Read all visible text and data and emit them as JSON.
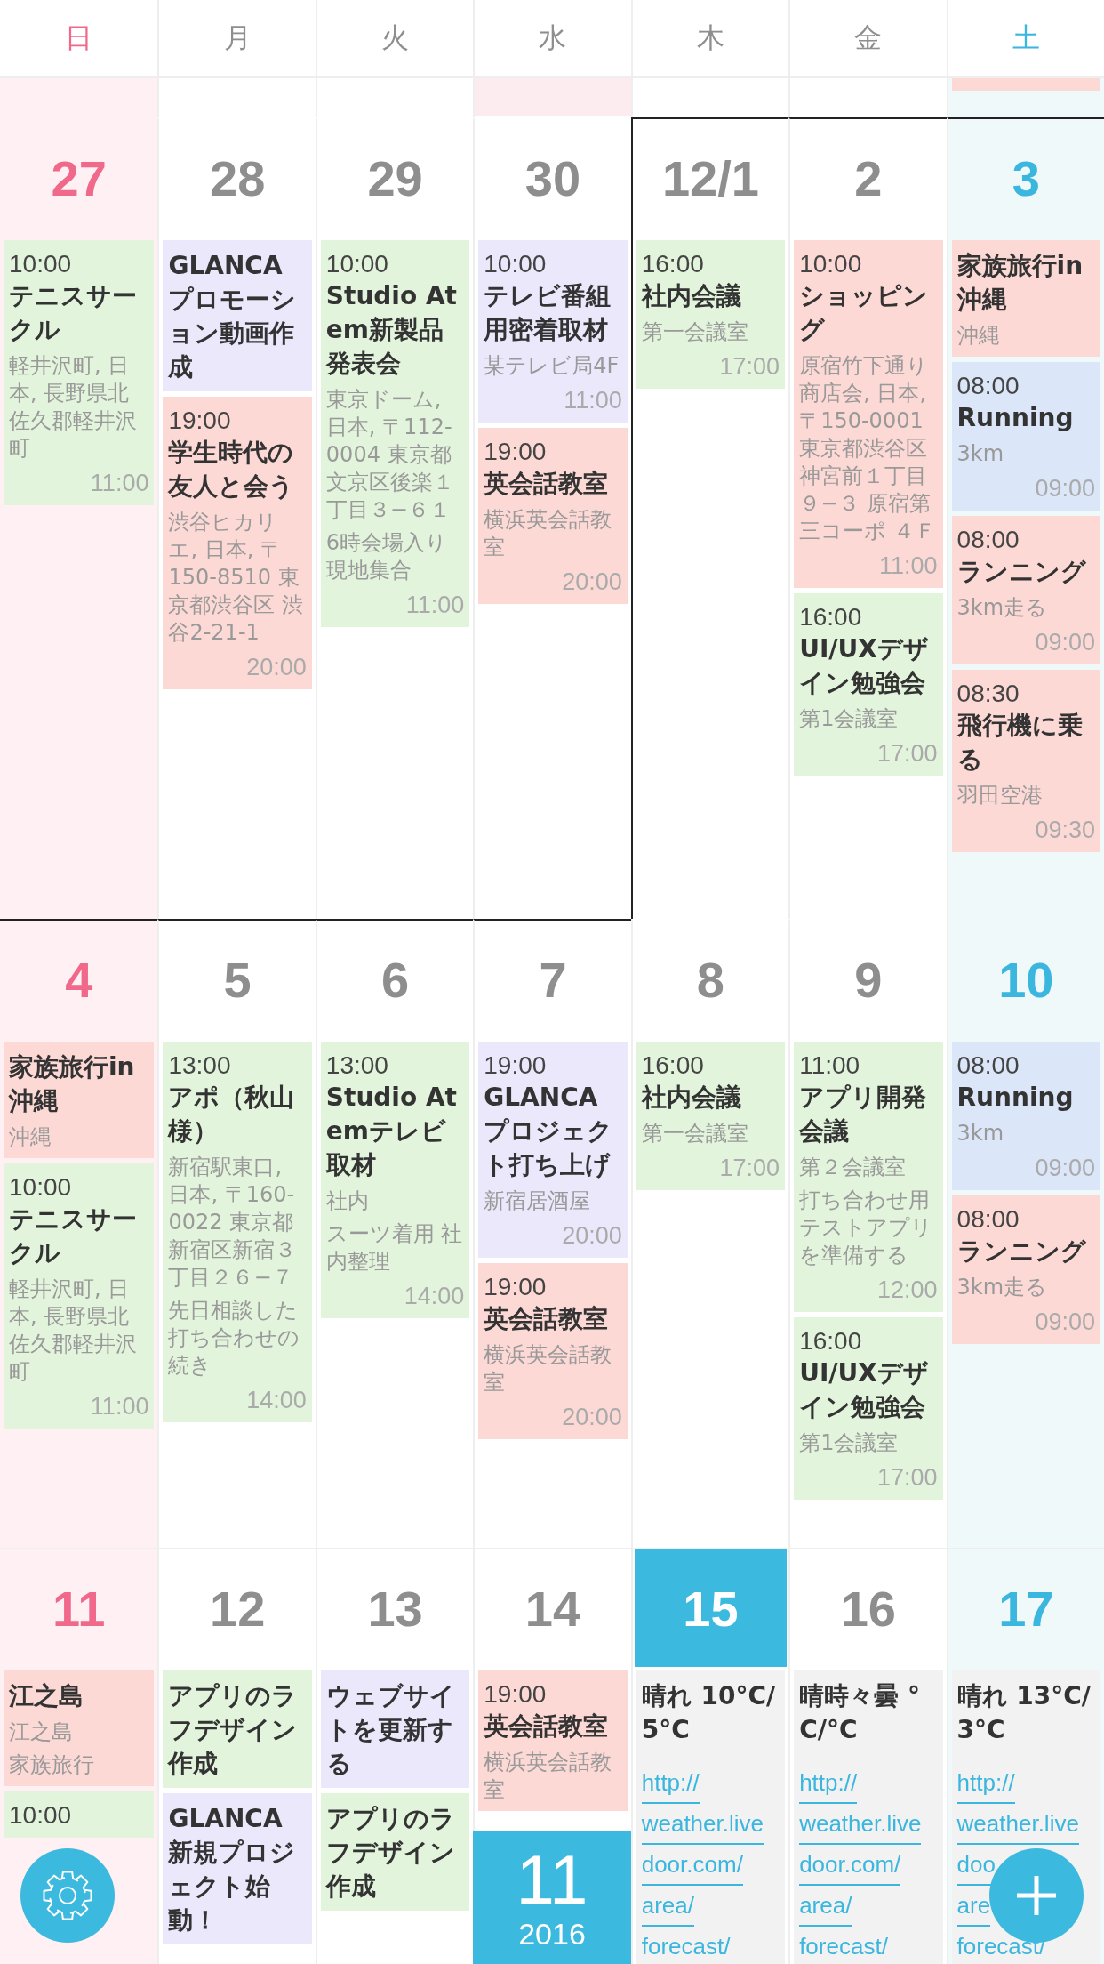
{
  "weekdays": [
    "日",
    "月",
    "火",
    "水",
    "木",
    "金",
    "土"
  ],
  "previous_week_edge": [
    {
      "kind": "none"
    },
    {
      "kind": "none"
    },
    {
      "kind": "none"
    },
    {
      "kind": "full",
      "color": "#fdecef"
    },
    {
      "kind": "none"
    },
    {
      "kind": "none"
    },
    {
      "kind": "edge",
      "color": "#fdd9d6"
    }
  ],
  "weeks": [
    {
      "days": [
        {
          "number": "27",
          "other_month": true,
          "today": false,
          "events": [
            {
              "kind": "event",
              "color": "#e3f4dc",
              "time": "10:00",
              "title": "テニスサークル",
              "details": [
                "軽井沢町, 日本, 長野県北佐久郡軽井沢町"
              ],
              "end": "11:00"
            }
          ]
        },
        {
          "number": "28",
          "other_month": true,
          "today": false,
          "events": [
            {
              "kind": "event",
              "color": "#ece8fc",
              "title": "GLANCAプロモーション動画作成"
            },
            {
              "kind": "event",
              "color": "#fdd9d6",
              "time": "19:00",
              "title": "学生時代の友人と会う",
              "details": [
                "渋谷ヒカリエ, 日本, 〒150-8510 東京都渋谷区 渋谷2-21-1"
              ],
              "end": "20:00"
            }
          ]
        },
        {
          "number": "29",
          "other_month": true,
          "today": false,
          "events": [
            {
              "kind": "event",
              "color": "#e3f4dc",
              "time": "10:00",
              "title": "Studio Atem新製品発表会",
              "details": [
                "東京ドーム, 日本, 〒112-0004 東京都文京区後楽１丁目３−６１",
                "6時会場入り現地集合"
              ],
              "end": "11:00"
            }
          ]
        },
        {
          "number": "30",
          "other_month": true,
          "today": false,
          "events": [
            {
              "kind": "event",
              "color": "#ece8fc",
              "time": "10:00",
              "title": "テレビ番組用密着取材",
              "details": [
                "某テレビ局4F"
              ],
              "end": "11:00"
            },
            {
              "kind": "event",
              "color": "#fdd9d6",
              "time": "19:00",
              "title": "英会話教室",
              "details": [
                "横浜英会話教室"
              ],
              "end": "20:00"
            }
          ]
        },
        {
          "number": "12/1",
          "other_month": false,
          "today": false,
          "events": [
            {
              "kind": "event",
              "color": "#e3f4dc",
              "time": "16:00",
              "title": "社内会議",
              "details": [
                "第一会議室"
              ],
              "end": "17:00"
            }
          ]
        },
        {
          "number": "2",
          "other_month": false,
          "today": false,
          "events": [
            {
              "kind": "event",
              "color": "#fdd9d6",
              "time": "10:00",
              "title": "ショッピング",
              "details": [
                "原宿竹下通り商店会, 日本, 〒150-0001 東京都渋谷区神宮前１丁目９−３ 原宿第三コーポ ４Ｆ"
              ],
              "end": "11:00"
            },
            {
              "kind": "event",
              "color": "#e3f4dc",
              "time": "16:00",
              "title": "UI/UXデザイン勉強会",
              "details": [
                "第1会議室"
              ],
              "end": "17:00"
            }
          ]
        },
        {
          "number": "3",
          "other_month": false,
          "today": false,
          "events": [
            {
              "kind": "event",
              "color": "#fdd9d6",
              "title": "家族旅行in沖縄",
              "details": [
                "沖縄"
              ]
            },
            {
              "kind": "event",
              "color": "#dbe6f8",
              "time": "08:00",
              "title": "Running",
              "details": [
                "3km"
              ],
              "end": "09:00"
            },
            {
              "kind": "event",
              "color": "#fdd9d6",
              "time": "08:00",
              "title": "ランニング",
              "details": [
                "3km走る"
              ],
              "end": "09:00"
            },
            {
              "kind": "event",
              "color": "#fdd9d6",
              "time": "08:30",
              "title": "飛行機に乗る",
              "details": [
                "羽田空港"
              ],
              "end": "09:30"
            }
          ]
        }
      ]
    },
    {
      "days": [
        {
          "number": "4",
          "today": false,
          "events": [
            {
              "kind": "event",
              "color": "#fdd9d6",
              "title": "家族旅行in沖縄",
              "details": [
                "沖縄"
              ]
            },
            {
              "kind": "event",
              "color": "#e3f4dc",
              "time": "10:00",
              "title": "テニスサークル",
              "details": [
                "軽井沢町, 日本, 長野県北佐久郡軽井沢町"
              ],
              "end": "11:00"
            }
          ]
        },
        {
          "number": "5",
          "today": false,
          "events": [
            {
              "kind": "event",
              "color": "#e3f4dc",
              "time": "13:00",
              "title": "アポ（秋山様）",
              "details": [
                "新宿駅東口, 日本, 〒160-0022 東京都新宿区新宿３丁目２６−７",
                "先日相談した打ち合わせの続き"
              ],
              "end": "14:00"
            }
          ]
        },
        {
          "number": "6",
          "today": false,
          "events": [
            {
              "kind": "event",
              "color": "#e3f4dc",
              "time": "13:00",
              "title": "Studio Atemテレビ取材",
              "details": [
                "社内",
                "スーツ着用 社内整理"
              ],
              "end": "14:00"
            }
          ]
        },
        {
          "number": "7",
          "today": false,
          "events": [
            {
              "kind": "event",
              "color": "#ece8fc",
              "time": "19:00",
              "title": "GLANCAプロジェクト打ち上げ",
              "details": [
                "新宿居酒屋"
              ],
              "end": "20:00"
            },
            {
              "kind": "event",
              "color": "#fdd9d6",
              "time": "19:00",
              "title": "英会話教室",
              "details": [
                "横浜英会話教室"
              ],
              "end": "20:00"
            }
          ]
        },
        {
          "number": "8",
          "today": false,
          "events": [
            {
              "kind": "event",
              "color": "#e3f4dc",
              "time": "16:00",
              "title": "社内会議",
              "details": [
                "第一会議室"
              ],
              "end": "17:00"
            }
          ]
        },
        {
          "number": "9",
          "today": false,
          "events": [
            {
              "kind": "event",
              "color": "#e3f4dc",
              "time": "11:00",
              "title": "アプリ開発会議",
              "details": [
                "第２会議室",
                "打ち合わせ用テストアプリを準備する"
              ],
              "end": "12:00"
            },
            {
              "kind": "event",
              "color": "#e3f4dc",
              "time": "16:00",
              "title": "UI/UXデザイン勉強会",
              "details": [
                "第1会議室"
              ],
              "end": "17:00"
            }
          ]
        },
        {
          "number": "10",
          "today": false,
          "events": [
            {
              "kind": "event",
              "color": "#dbe6f8",
              "time": "08:00",
              "title": "Running",
              "details": [
                "3km"
              ],
              "end": "09:00"
            },
            {
              "kind": "event",
              "color": "#fdd9d6",
              "time": "08:00",
              "title": "ランニング",
              "details": [
                "3km走る"
              ],
              "end": "09:00"
            }
          ]
        }
      ]
    },
    {
      "days": [
        {
          "number": "11",
          "today": false,
          "events": [
            {
              "kind": "event",
              "color": "#fdd9d6",
              "title": "江之島",
              "details": [
                "江之島",
                "家族旅行"
              ]
            },
            {
              "kind": "event",
              "color": "#e3f4dc",
              "time": "10:00"
            }
          ]
        },
        {
          "number": "12",
          "today": false,
          "events": [
            {
              "kind": "event",
              "color": "#e3f4dc",
              "title": "アプリのラフデザイン作成"
            },
            {
              "kind": "event",
              "color": "#ece8fc",
              "title": "GLANCA新規プロジェクト始動！"
            }
          ]
        },
        {
          "number": "13",
          "today": false,
          "events": [
            {
              "kind": "event",
              "color": "#ece8fc",
              "title": "ウェブサイトを更新する"
            },
            {
              "kind": "event",
              "color": "#e3f4dc",
              "title": "アプリのラフデザイン作成"
            }
          ]
        },
        {
          "number": "14",
          "today": false,
          "events": [
            {
              "kind": "event",
              "color": "#fdd9d6",
              "time": "19:00",
              "title": "英会話教室",
              "details": [
                "横浜英会話教室"
              ]
            }
          ]
        },
        {
          "number": "15",
          "today": true,
          "events": [
            {
              "kind": "weather",
              "color": "#f2f2f2",
              "title": "晴れ 10°C/5°C",
              "link_lines": [
                "http://",
                "weather.live",
                "door.com/",
                "area/",
                "forecast/"
              ]
            }
          ]
        },
        {
          "number": "16",
          "today": false,
          "events": [
            {
              "kind": "weather",
              "color": "#f2f2f2",
              "title": "晴時々曇 °C/°C",
              "link_lines": [
                "http://",
                "weather.live",
                "door.com/",
                "area/",
                "forecast/"
              ]
            }
          ]
        },
        {
          "number": "17",
          "today": false,
          "events": [
            {
              "kind": "weather",
              "color": "#f2f2f2",
              "title": "晴れ 13°C/3°C",
              "link_lines": [
                "http://",
                "weather.live",
                "doo",
                "are",
                "forecast/"
              ]
            }
          ]
        }
      ]
    }
  ],
  "month_badge": {
    "month": "11",
    "year": "2016"
  }
}
